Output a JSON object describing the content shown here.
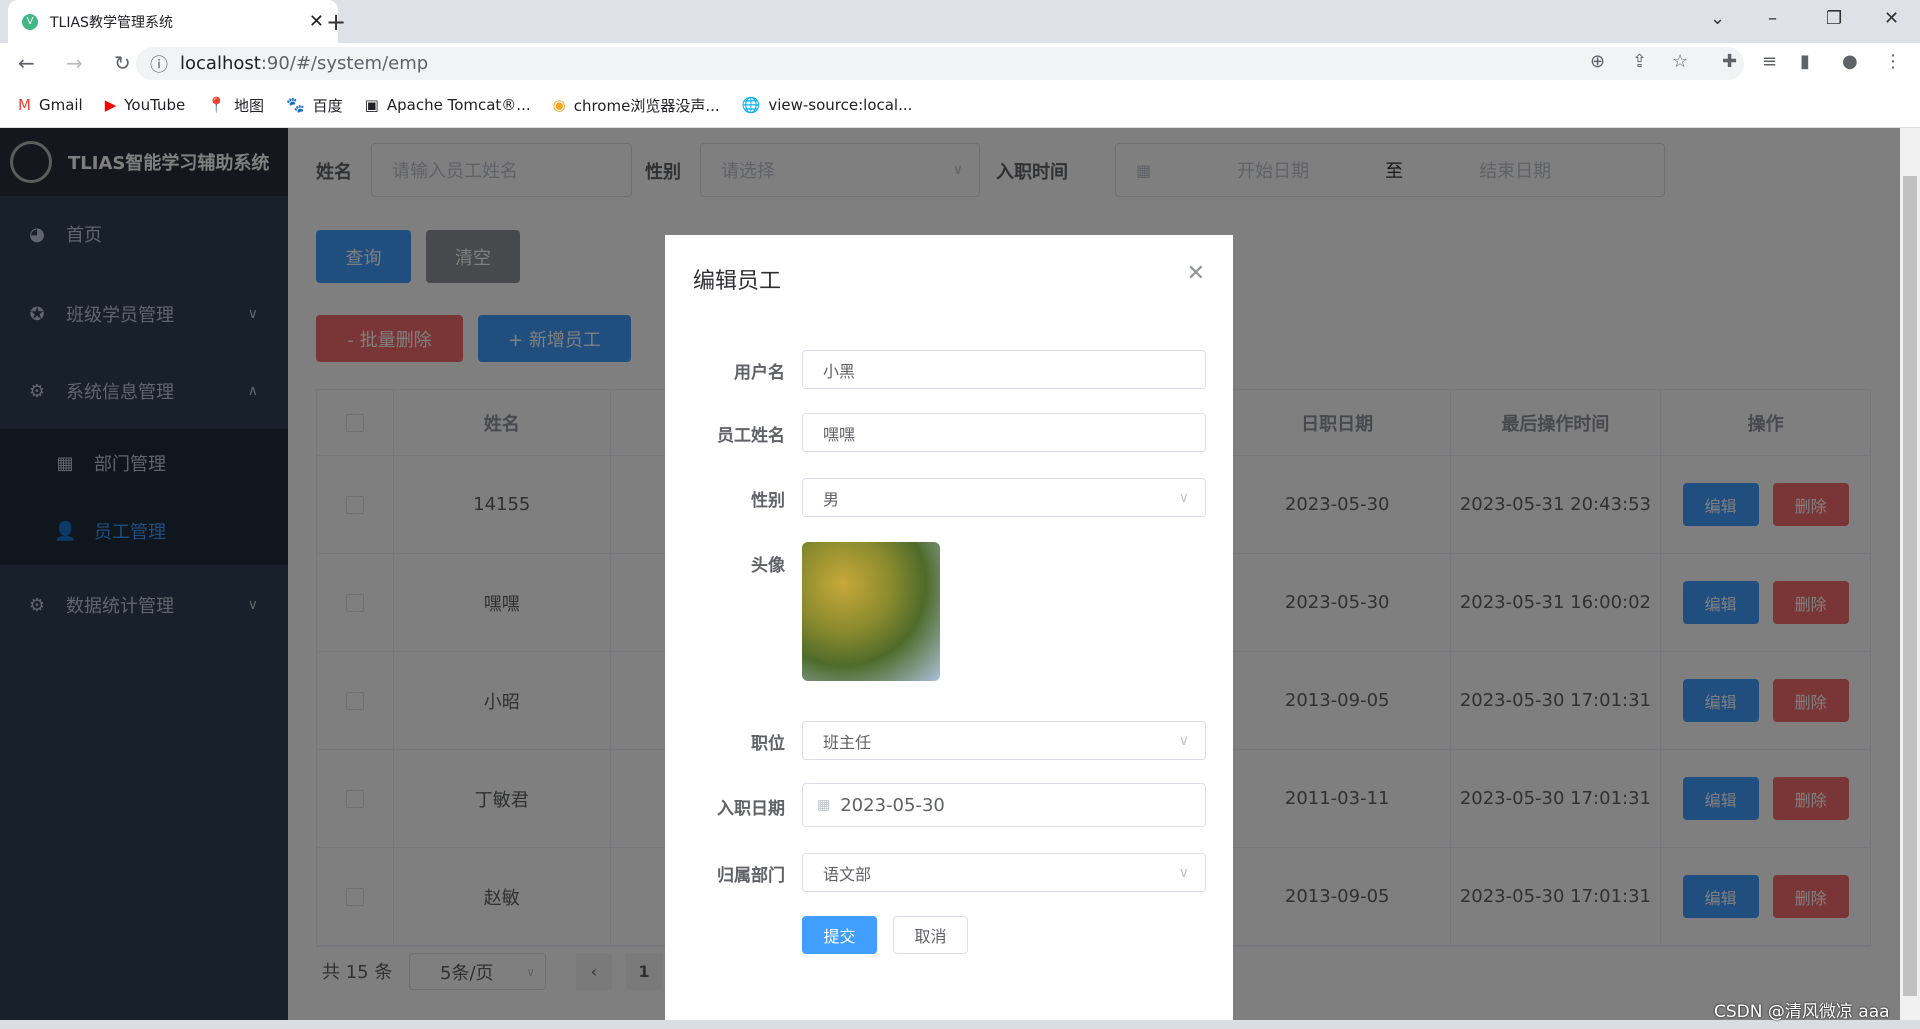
{
  "browser": {
    "tab_title": "TLIAS教学管理系统",
    "url_host": "localhost",
    "url_path": ":90/#/system/emp",
    "bookmarks": [
      {
        "label": "Gmail",
        "icon": "gmail-icon"
      },
      {
        "label": "YouTube",
        "icon": "youtube-icon"
      },
      {
        "label": "地图",
        "icon": "maps-icon"
      },
      {
        "label": "百度",
        "icon": "baidu-icon"
      },
      {
        "label": "Apache Tomcat®...",
        "icon": "tomcat-icon"
      },
      {
        "label": "chrome浏览器没声...",
        "icon": "page-icon"
      },
      {
        "label": "view-source:local...",
        "icon": "globe-icon"
      }
    ]
  },
  "sidebar": {
    "logo_text": "TLIAS智能学习辅助系统",
    "items": [
      {
        "label": "首页",
        "icon": "dashboard-icon"
      },
      {
        "label": "班级学员管理",
        "icon": "circle-icon"
      },
      {
        "label": "系统信息管理",
        "icon": "gear-icon"
      },
      {
        "label": "部门管理",
        "icon": "grid-icon"
      },
      {
        "label": "员工管理",
        "icon": "user-icon"
      },
      {
        "label": "数据统计管理",
        "icon": "gear-icon"
      }
    ]
  },
  "search": {
    "name_label": "姓名",
    "name_placeholder": "请输入员工姓名",
    "gender_label": "性别",
    "gender_placeholder": "请选择",
    "date_label": "入职时间",
    "start_placeholder": "开始日期",
    "range_sep": "至",
    "end_placeholder": "结束日期",
    "query": "查询",
    "clear": "清空"
  },
  "actions": {
    "batch_delete": "- 批量删除",
    "add": "+ 新增员工"
  },
  "table": {
    "headers": [
      "姓名",
      "日职日期",
      "最后操作时间",
      "操作"
    ],
    "rows": [
      {
        "name": "14155",
        "date": "2023-05-30",
        "updated": "2023-05-31 20:43:53"
      },
      {
        "name": "嘿嘿",
        "date": "2023-05-30",
        "updated": "2023-05-31 16:00:02"
      },
      {
        "name": "小昭",
        "date": "2013-09-05",
        "updated": "2023-05-30 17:01:31"
      },
      {
        "name": "丁敏君",
        "date": "2011-03-11",
        "updated": "2023-05-30 17:01:31"
      },
      {
        "name": "赵敏",
        "date": "2013-09-05",
        "updated": "2023-05-30 17:01:31"
      }
    ],
    "edit": "编辑",
    "delete": "删除"
  },
  "pagination": {
    "total": "共 15 条",
    "page_size": "5条/页",
    "current": "1"
  },
  "modal": {
    "title": "编辑员工",
    "fields": {
      "username_label": "用户名",
      "username": "小黑",
      "name_label": "员工姓名",
      "name": "嘿嘿",
      "gender_label": "性别",
      "gender": "男",
      "avatar_label": "头像",
      "job_label": "职位",
      "job": "班主任",
      "entry_label": "入职日期",
      "entry": "2023-05-30",
      "dept_label": "归属部门",
      "dept": "语文部"
    },
    "submit": "提交",
    "cancel": "取消"
  },
  "watermark": "CSDN @清风微凉 aaa",
  "colors": {
    "primary": "#409eff",
    "danger": "#f56c6c",
    "info": "#909399",
    "sidebar": "#304156"
  }
}
